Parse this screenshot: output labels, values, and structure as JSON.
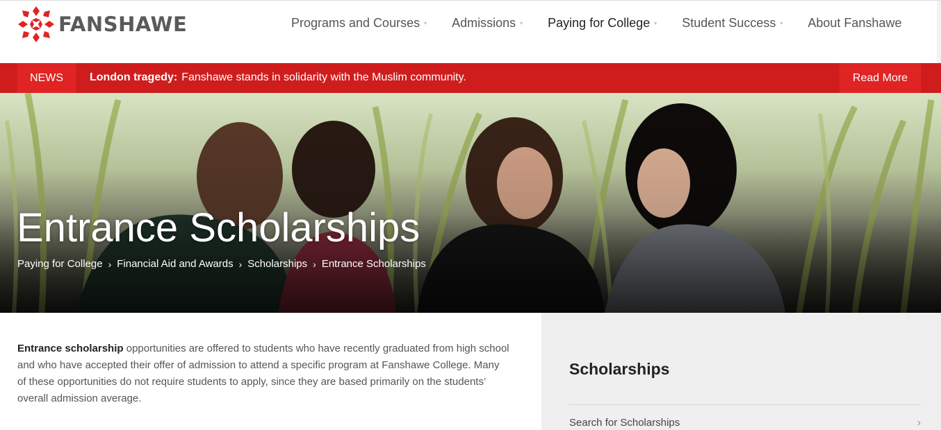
{
  "header": {
    "logo_text": "FANSHAWE",
    "nav": [
      {
        "label": "Programs and Courses",
        "caret": "▾"
      },
      {
        "label": "Admissions",
        "caret": "▾"
      },
      {
        "label": "Paying for College",
        "caret": "▾"
      },
      {
        "label": "Student Success",
        "caret": "▾"
      },
      {
        "label": "About Fanshawe",
        "caret": ""
      }
    ]
  },
  "news": {
    "tag": "NEWS",
    "headline_bold": "London tragedy:",
    "headline": "Fanshawe stands in solidarity with the Muslim community.",
    "read_more": "Read More"
  },
  "hero": {
    "title": "Entrance Scholarships",
    "breadcrumb": [
      "Paying for College",
      "Financial Aid and Awards",
      "Scholarships",
      "Entrance Scholarships"
    ],
    "separator": "›"
  },
  "content": {
    "intro_bold": "Entrance scholarship",
    "intro_rest": " opportunities are offered to students who have recently graduated from high school and who have accepted their offer of admission to attend a specific program at Fanshawe College. Many of these opportunities do not require students to apply, since they are based primarily on the students’ overall admission average."
  },
  "sidebar": {
    "title": "Scholarships",
    "links": [
      {
        "label": "Search for Scholarships",
        "chevron": "›"
      }
    ]
  },
  "colors": {
    "brand_red": "#cf1d1d",
    "accent_red": "#e02424",
    "sidebar_bg": "#efefef"
  },
  "icons": {
    "logo": "fanshawe-logo-icon",
    "caret": "chevron-down-icon",
    "chevron": "chevron-right-icon"
  }
}
